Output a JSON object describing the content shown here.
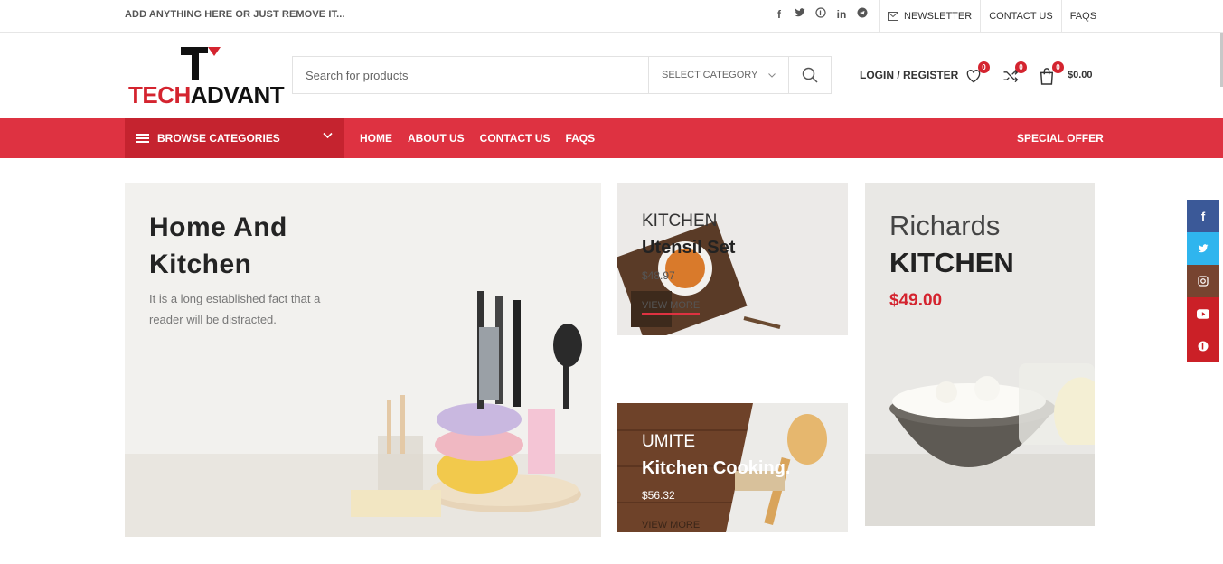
{
  "topbar": {
    "promo": "ADD ANYTHING HERE OR JUST REMOVE IT...",
    "social_icons": [
      "facebook-icon",
      "twitter-icon",
      "pinterest-icon",
      "linkedin-icon",
      "telegram-icon"
    ],
    "links": {
      "newsletter": "NEWSLETTER",
      "contact": "CONTACT US",
      "faqs": "FAQS"
    }
  },
  "header": {
    "logo_text_a": "TECH",
    "logo_text_b": "ADVANT",
    "search_placeholder": "Search for products",
    "category_select": "SELECT CATEGORY",
    "login": "LOGIN / REGISTER",
    "wishlist_count": "0",
    "compare_count": "0",
    "cart_count": "0",
    "cart_total": "$0.00"
  },
  "nav": {
    "browse": "BROWSE CATEGORIES",
    "links": [
      "HOME",
      "ABOUT US",
      "CONTACT US",
      "FAQS"
    ],
    "special": "SPECIAL OFFER"
  },
  "banners": {
    "main": {
      "title": "Home And Kitchen",
      "text": "It is a long established fact that a reader will be distracted."
    },
    "utensil": {
      "subtitle": "KITCHEN",
      "title": "Utensil Set",
      "price": "$48.97",
      "more": "VIEW MORE"
    },
    "cooking": {
      "subtitle": "UMITE",
      "title": "Kitchen Cooking.",
      "price": "$56.32",
      "more": "VIEW MORE"
    },
    "richards": {
      "subtitle": "Richards",
      "title": "KITCHEN",
      "price": "$49.00"
    }
  },
  "side_social": [
    {
      "icon": "facebook-icon",
      "color": "#3b5998"
    },
    {
      "icon": "twitter-icon",
      "color": "#2fb5ee"
    },
    {
      "icon": "instagram-icon",
      "color": "#774430"
    },
    {
      "icon": "youtube-icon",
      "color": "#cb2027"
    },
    {
      "icon": "pinterest-icon",
      "color": "#cb2027"
    }
  ],
  "colors": {
    "brand_red": "#de3241",
    "brand_red_dark": "#c5232f"
  }
}
